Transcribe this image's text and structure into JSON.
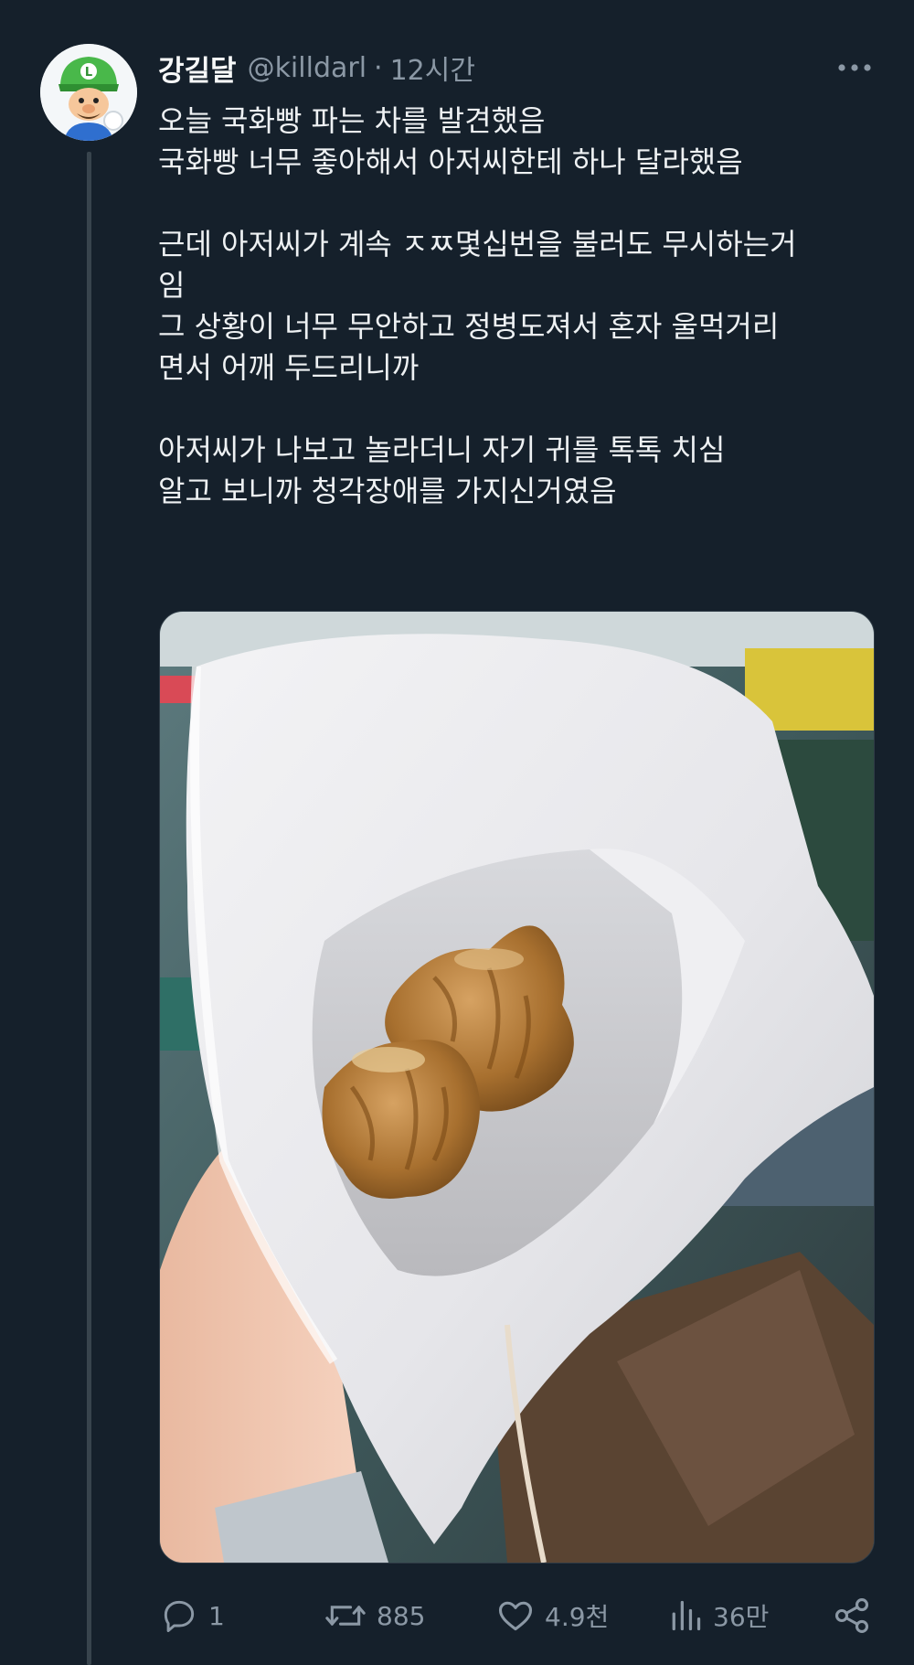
{
  "tweet": {
    "author": {
      "name": "강길달",
      "handle": "@killdarl",
      "separator": "·",
      "time": "12시간"
    },
    "lines": [
      "오늘 국화빵 파는 차를 발견했음",
      "국화빵 너무 좋아해서 아저씨한테 하나 달라했음",
      "",
      "근데 아저씨가 계속 ㅈㅉ몇십번을 불러도 무시하는거",
      "임",
      "그 상황이 너무 무안하고 정병도져서 혼자 울먹거리",
      "면서 어깨 두드리니까",
      "",
      "아저씨가 나보고 놀라더니 자기 귀를 톡톡 치심",
      "알고 보니까 청각장애를 가지신거였음"
    ],
    "media": {
      "description_icon": "photo-of-gukhwa-bread-in-paper-bag"
    },
    "actions": {
      "reply_count": "1",
      "retweet_count": "885",
      "like_count": "4.9천",
      "view_count": "36만"
    }
  },
  "colors": {
    "background": "#15202b",
    "text": "#e7e9ea",
    "secondary": "#8b98a5",
    "thread_line": "#38444d"
  }
}
